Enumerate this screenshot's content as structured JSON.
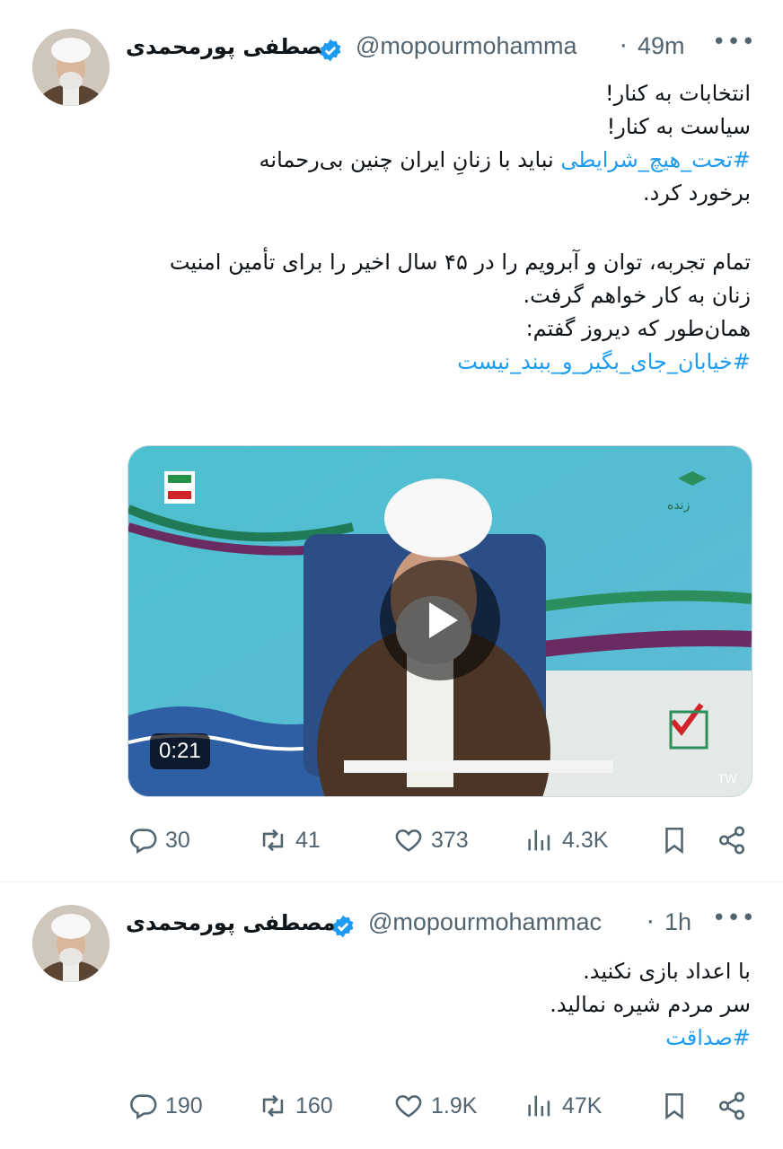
{
  "tweets": [
    {
      "display_name": "مصطفی پورمحمدی",
      "handle": "@mopourmohamma",
      "separator": "·",
      "time": "49m",
      "more": "•••",
      "lines": [
        {
          "text": "انتخابات به کنار!",
          "tag": ""
        },
        {
          "text": "سیاست به کنار!",
          "tag": ""
        },
        {
          "tag": "#تحت_هیچ_شرایطی",
          "text": " نباید با زنانِ ایران چنین بی‌رحمانه"
        },
        {
          "text": "برخورد کرد.",
          "tag": ""
        },
        {
          "text": "",
          "tag": ""
        },
        {
          "text": "تمام تجربه، توان و آبرویم را در ۴۵ سال اخیر را برای تأمین امنیت",
          "tag": ""
        },
        {
          "text": "زنان به کار خواهم گرفت.",
          "tag": ""
        },
        {
          "text": "همان‌طور که دیروز گفتم:",
          "tag": ""
        },
        {
          "tag": "#خیابان_جای_بگیر_و_ببند_نیست",
          "text": ""
        }
      ],
      "video": {
        "duration": "0:21",
        "watermark": "TW",
        "channel_label": "زنده"
      },
      "stats": {
        "replies": "30",
        "reposts": "41",
        "likes": "373",
        "views": "4.3K"
      }
    },
    {
      "display_name": "مصطفی پورمحمدی",
      "handle": "@mopourmohammac",
      "separator": "·",
      "time": "1h",
      "more": "•••",
      "lines": [
        {
          "text": "با اعداد بازی نکنید.",
          "tag": ""
        },
        {
          "text": "سر مردم شیره نمالید.",
          "tag": ""
        },
        {
          "tag": "#صداقت",
          "text": ""
        }
      ],
      "stats": {
        "replies": "190",
        "reposts": "160",
        "likes": "1.9K",
        "views": "47K"
      }
    }
  ],
  "icons": {
    "reply": "reply-icon",
    "repost": "repost-icon",
    "like": "heart-icon",
    "views": "views-icon",
    "bookmark": "bookmark-icon",
    "share": "share-icon",
    "verified": "verified-badge-icon"
  },
  "colors": {
    "link": "#1d9bf0",
    "muted": "#536471",
    "verified": "#1d9bf0"
  }
}
